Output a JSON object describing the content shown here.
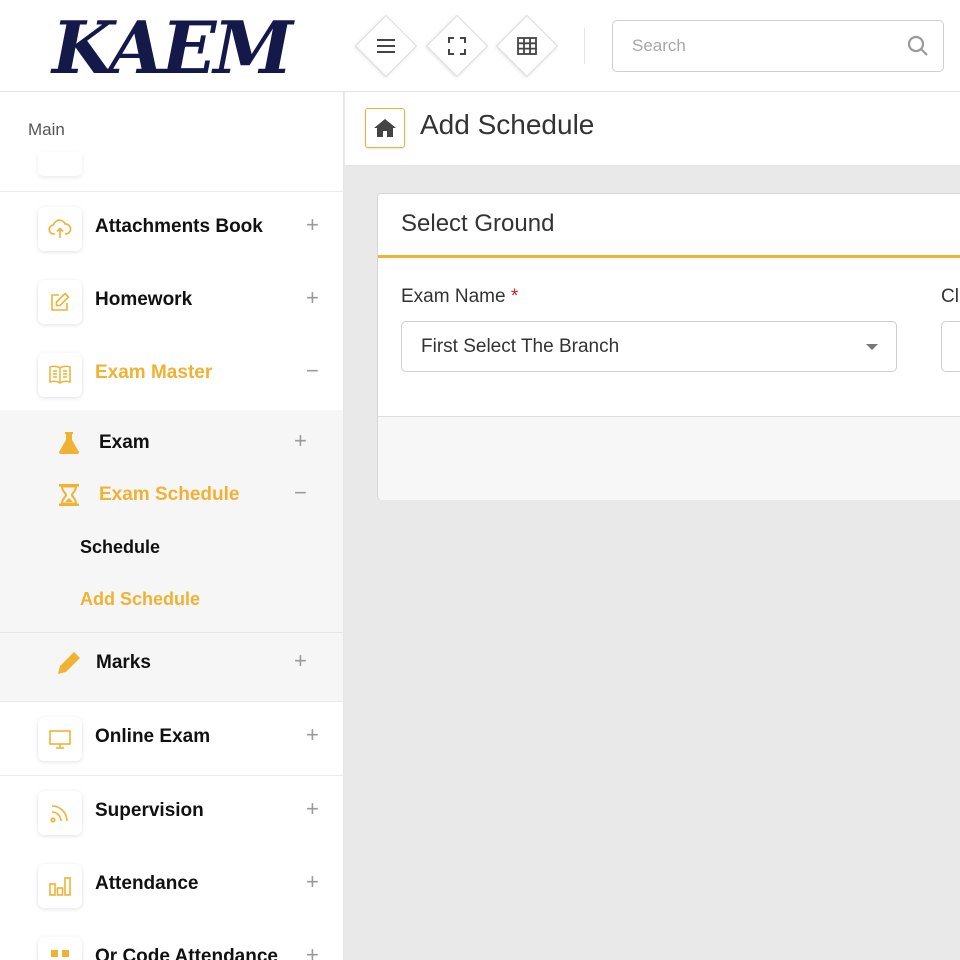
{
  "header": {
    "logo_text": "KAEM",
    "search_placeholder": "Search"
  },
  "sidebar": {
    "section_label": "Main",
    "items": [
      {
        "label": "Attachments Book",
        "toggle": "+",
        "icon": "cloud-upload-icon"
      },
      {
        "label": "Homework",
        "toggle": "+",
        "icon": "edit-icon"
      },
      {
        "label": "Exam Master",
        "toggle": "−",
        "icon": "book-icon",
        "active": true
      },
      {
        "label": "Online Exam",
        "toggle": "+",
        "icon": "monitor-icon"
      },
      {
        "label": "Supervision",
        "toggle": "+",
        "icon": "rss-icon"
      },
      {
        "label": "Attendance",
        "toggle": "+",
        "icon": "bar-chart-icon"
      },
      {
        "label": "Qr Code Attendance",
        "toggle": "+",
        "icon": "qr-code-icon"
      }
    ],
    "exam_master_sub": [
      {
        "label": "Exam",
        "toggle": "+",
        "icon": "flask-icon"
      },
      {
        "label": "Exam Schedule",
        "toggle": "−",
        "icon": "hourglass-icon",
        "active": true
      },
      {
        "label": "Marks",
        "toggle": "+",
        "icon": "pencil-icon"
      }
    ],
    "exam_schedule_sub": [
      {
        "label": "Schedule"
      },
      {
        "label": "Add Schedule",
        "active": true
      }
    ]
  },
  "page": {
    "title": "Add Schedule"
  },
  "card": {
    "title": "Select Ground",
    "exam_name_label": "Exam Name",
    "required_mark": "*",
    "exam_name_value": "First Select The Branch",
    "second_label": "Cl"
  },
  "colors": {
    "accent": "#f0b232",
    "logo": "#14194a",
    "required": "#c62828"
  }
}
